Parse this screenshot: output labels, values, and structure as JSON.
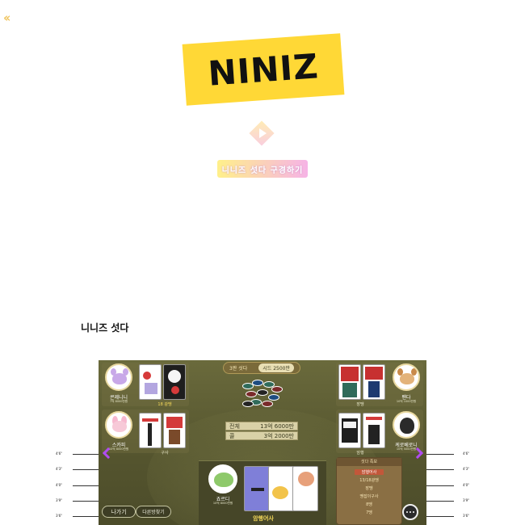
{
  "header": {
    "back_icon": "double-chevron-left-icon",
    "logo_text": "NINIZ",
    "play_icon": "play-icon",
    "cta_label": "니니즈 섯다 구경하기"
  },
  "section": {
    "title": "니니즈 섯다"
  },
  "game": {
    "round_label": "3판 섯다",
    "seed_label": "시드 2500만",
    "pot": [
      {
        "label": "전체",
        "value": "13억 6000만"
      },
      {
        "label": "콜",
        "value": "3억 2000만"
      }
    ],
    "players": [
      {
        "name": "콘제니니",
        "money": "7억 8000만원",
        "hand": "18 광땡"
      },
      {
        "name": "스카피",
        "money": "10억 8000만원",
        "hand": "구사"
      },
      {
        "name": "팬다",
        "money": "10억 1000만원",
        "hand": "장땡"
      },
      {
        "name": "케로베로니",
        "money": "10억 5000만원",
        "hand": "암행"
      }
    ],
    "me": {
      "name": "죠르디",
      "money": "10억 8000만원",
      "hand": "암행어사"
    },
    "buttons": {
      "leave": "나가기",
      "other_room": "다른방찾기"
    },
    "rules": {
      "title": "섯다 족보",
      "items": [
        "암행어사",
        "13/18광땡",
        "장땡",
        "땡잡이구사",
        "8땡",
        "7땡"
      ],
      "highlight_index": 0
    },
    "chat_icon": "chat-bubble-icon",
    "nav": {
      "left_icon": "chevron-left-icon",
      "right_icon": "chevron-right-icon"
    }
  },
  "dimensions": {
    "left": [
      "4'6\"",
      "4'3\"",
      "4'0\"",
      "3'9\"",
      "3'6\""
    ],
    "right": [
      "4'6\"",
      "4'3\"",
      "4'0\"",
      "3'9\"",
      "3'6\""
    ]
  },
  "colors": {
    "accent": "#b04cf0",
    "logo_bg": "#ffd836",
    "board": "#5a5a32",
    "hand_gold": "#f4d85a"
  }
}
